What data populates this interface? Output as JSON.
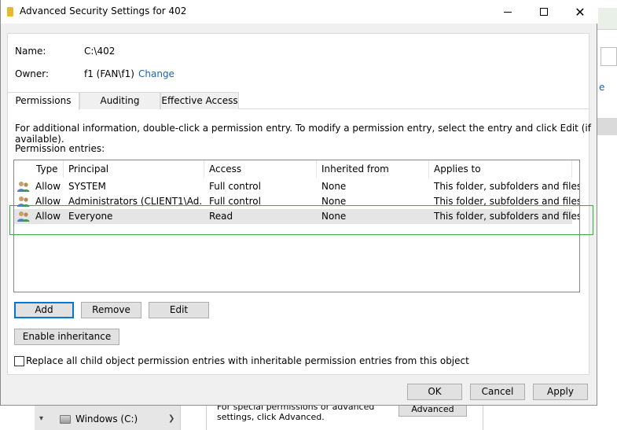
{
  "window": {
    "title": "Advanced Security Settings for 402",
    "minimize": "",
    "maximize": "",
    "close": "✕"
  },
  "info": {
    "name_label": "Name:",
    "name_value": "C:\\402",
    "owner_label": "Owner:",
    "owner_value": "f1 (FAN\\f1)",
    "change_link": "Change"
  },
  "tabs": [
    {
      "label": "Permissions",
      "active": true
    },
    {
      "label": "Auditing",
      "active": false
    },
    {
      "label": "Effective Access",
      "active": false
    }
  ],
  "description": "For additional information, double-click a permission entry. To modify a permission entry, select the entry and click Edit (if available).",
  "permission_entries_label": "Permission entries:",
  "table": {
    "headers": [
      "Type",
      "Principal",
      "Access",
      "Inherited from",
      "Applies to"
    ],
    "rows": [
      {
        "type": "Allow",
        "principal": "SYSTEM",
        "access": "Full control",
        "inherited": "None",
        "applies": "This folder, subfolders and files",
        "selected": false
      },
      {
        "type": "Allow",
        "principal": "Administrators (CLIENT1\\Ad...",
        "access": "Full control",
        "inherited": "None",
        "applies": "This folder, subfolders and files",
        "selected": false
      },
      {
        "type": "Allow",
        "principal": "Everyone",
        "access": "Read",
        "inherited": "None",
        "applies": "This folder, subfolders and files",
        "selected": true
      }
    ]
  },
  "buttons": {
    "add": "Add",
    "remove": "Remove",
    "edit": "Edit",
    "enable_inheritance": "Enable inheritance",
    "ok": "OK",
    "cancel": "Cancel",
    "apply": "Apply"
  },
  "replace_checkbox": {
    "label": "Replace all child object permission entries with inheritable permission entries from this object",
    "checked": false
  },
  "background": {
    "drive_label": "Windows (C:)",
    "advanced_text": "For special permissions or advanced settings, click Advanced.",
    "advanced_button": "Advanced",
    "right_text": "e"
  },
  "colors": {
    "highlight_border": "#3bab3b",
    "link": "#1a62c4",
    "selected_row": "#e5e5e5"
  }
}
